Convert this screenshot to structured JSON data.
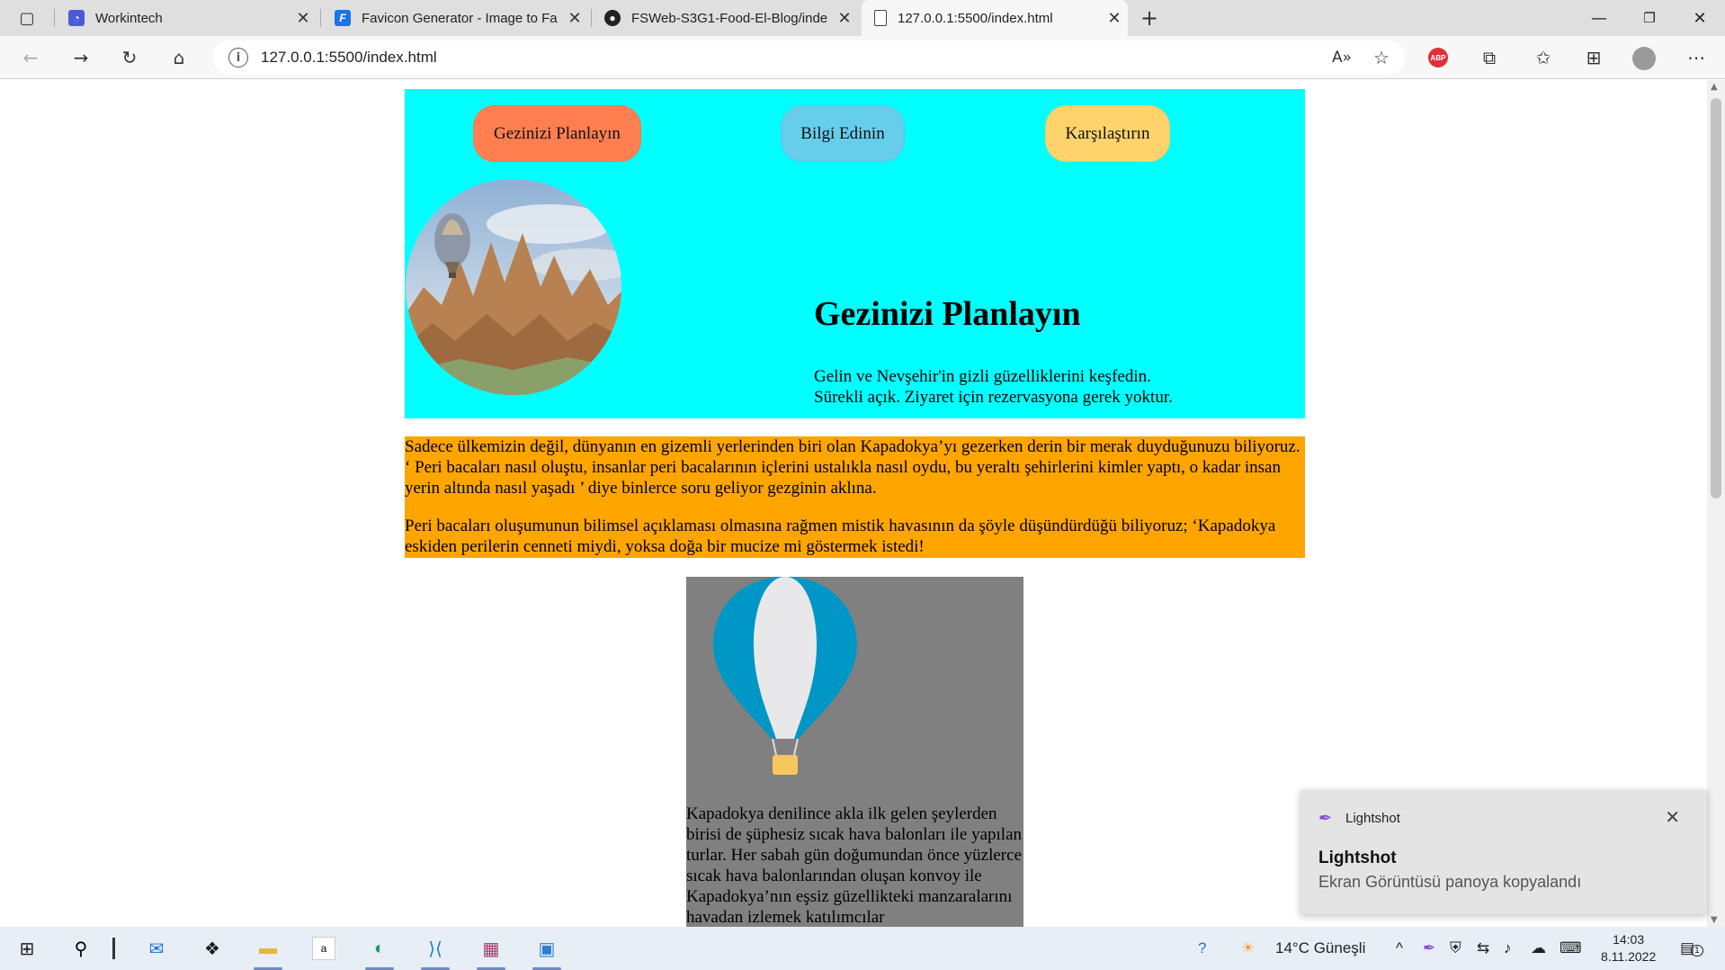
{
  "browser": {
    "tabs": [
      {
        "title": "Workintech",
        "icon": "workintech-icon"
      },
      {
        "title": "Favicon Generator - Image to Fa",
        "icon": "favicon-generator-icon"
      },
      {
        "title": "FSWeb-S3G1-Food-El-Blog/inde",
        "icon": "github-icon"
      },
      {
        "title": "127.0.0.1:5500/index.html",
        "icon": "document-icon"
      }
    ],
    "address": "127.0.0.1:5500/index.html",
    "abp_label": "ABP"
  },
  "page": {
    "nav": [
      "Gezinizi Planlayın",
      "Bilgi Edinin",
      "Karşılaştırın"
    ],
    "nav_colors": [
      "#ff7f50",
      "#66cdeb",
      "#ffd36b"
    ],
    "hero_title": "Gezinizi Planlayın",
    "hero_sub_1": "Gelin ve Nevşehir'in gizli güzelliklerini keşfedin.",
    "hero_sub_2": "Sürekli açık. Ziyaret için rezervasyona gerek yoktur.",
    "intro_p1": "Sadece ülkemizin değil, dünyanın en gizemli yerlerinden biri olan Kapadokya’yı gezerken derin bir merak duyduğunuzu biliyoruz. ‘ Peri bacaları nasıl oluştu, insanlar peri bacalarının içlerini ustalıkla nasıl oydu, bu yeraltı şehirlerini kimler yaptı, o kadar insan yerin altında nasıl yaşadı ’ diye binlerce soru geliyor gezginin aklına.",
    "intro_p2": "Peri bacaları oluşumunun bilimsel açıklaması olmasına rağmen mistik havasının da şöyle düşündürdüğü biliyoruz; ‘Kapadokya eskiden perilerin cenneti miydi, yoksa doğa bir mucize mi göstermek istedi!",
    "card_text": "Kapadokya denilince akla ilk gelen şeylerden birisi de şüphesiz sıcak hava balonları ile yapılan turlar. Her sabah gün doğumundan önce yüzlerce sıcak hava balonlarından oluşan konvoy ile Kapadokya’nın eşsiz güzellikteki manzaralarını havadan izlemek katılımcılar"
  },
  "toast": {
    "app": "Lightshot",
    "title": "Lightshot",
    "message": "Ekran Görüntüsü panoya kopyalandı"
  },
  "taskbar": {
    "weather": "14°C  Güneşli",
    "time": "14:03",
    "date": "8.11.2022",
    "notification_count": "1"
  },
  "colors": {
    "hero_bg": "#00ffff",
    "intro_bg": "#ffa500",
    "card_bg": "#808080"
  }
}
